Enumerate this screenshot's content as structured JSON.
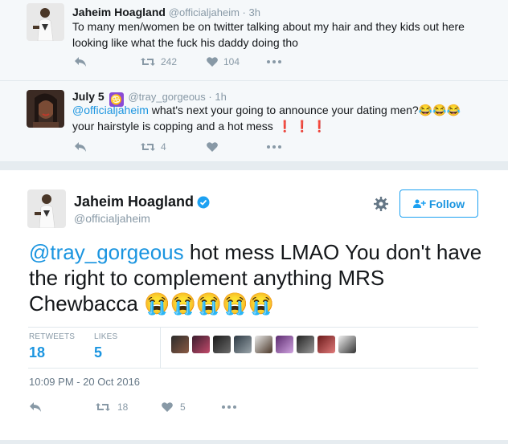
{
  "reply1": {
    "name": "Jaheim Hoagland",
    "handle": "@officialjaheim · 3h",
    "text": "To many men/women be on twitter talking about my hair and they kids out here looking like what the fuck his daddy doing tho",
    "retweets": "242",
    "likes": "104"
  },
  "reply2": {
    "name": "July 5",
    "badge": "♋",
    "handle": "@tray_gorgeous · 1h",
    "mention": "@officialjaheim",
    "text": " what's next your going to announce your dating men?",
    "emoji1": "😂😂😂",
    "text2": "your hairstyle is copping and a hot mess",
    "bangs": "❗ ❗ ❗",
    "retweets": "4"
  },
  "main": {
    "name": "Jaheim Hoagland",
    "handle": "@officialjaheim",
    "follow_label": "Follow",
    "mention": "@tray_gorgeous",
    "text": " hot mess LMAO You don't have the right to complement anything MRS Chewbacca ",
    "emoji": "😭😭😭😭😭",
    "retweets_label": "RETWEETS",
    "retweets_value": "18",
    "likes_label": "LIKES",
    "likes_value": "5",
    "timestamp": "10:09 PM - 20 Oct 2016",
    "action_retweets": "18",
    "action_likes": "5"
  },
  "colors": {
    "accent": "#1b95e0",
    "muted": "#8899a6",
    "background": "#f5f8fa"
  },
  "icons": [
    "reply-icon",
    "retweet-icon",
    "heart-icon",
    "more-icon",
    "gear-icon",
    "verified-icon",
    "add-user-icon"
  ]
}
